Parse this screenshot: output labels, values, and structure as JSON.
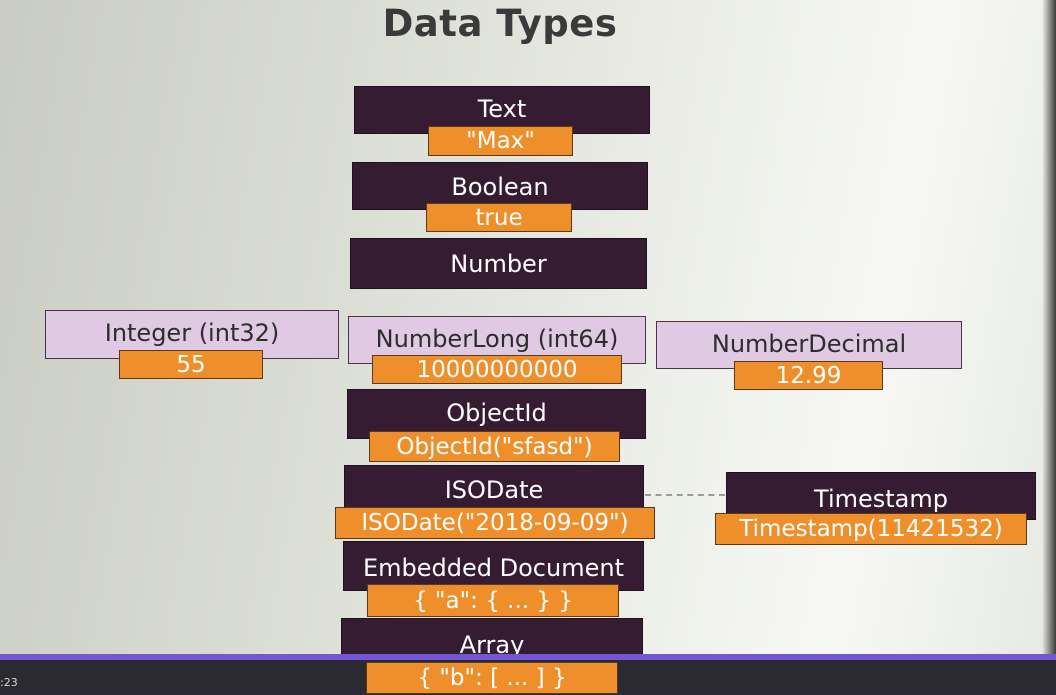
{
  "title": "Data Types",
  "boxes": {
    "text": {
      "label": "Text",
      "value": "\"Max\""
    },
    "boolean": {
      "label": "Boolean",
      "value": "true"
    },
    "number": {
      "label": "Number"
    },
    "integer": {
      "label": "Integer (int32)",
      "value": "55"
    },
    "numberlong": {
      "label": "NumberLong (int64)",
      "value": "10000000000"
    },
    "numberdecimal": {
      "label": "NumberDecimal",
      "value": "12.99"
    },
    "objectid": {
      "label": "ObjectId",
      "value": "ObjectId(\"sfasd\")"
    },
    "isodate": {
      "label": "ISODate",
      "value": "ISODate(\"2018-09-09\")"
    },
    "timestamp": {
      "label": "Timestamp",
      "value": "Timestamp(11421532)"
    },
    "embedded": {
      "label": "Embedded Document",
      "value": "{ \"a\": { ... } }"
    },
    "array": {
      "label": "Array",
      "value": "{ \"b\": [ ... ] }"
    }
  },
  "footer": {
    "corner_text": ":23"
  },
  "colors": {
    "dark_box": "#351c33",
    "light_box": "#dfc9e3",
    "value_box": "#ee8f2c",
    "accent_line": "#7355d6"
  }
}
